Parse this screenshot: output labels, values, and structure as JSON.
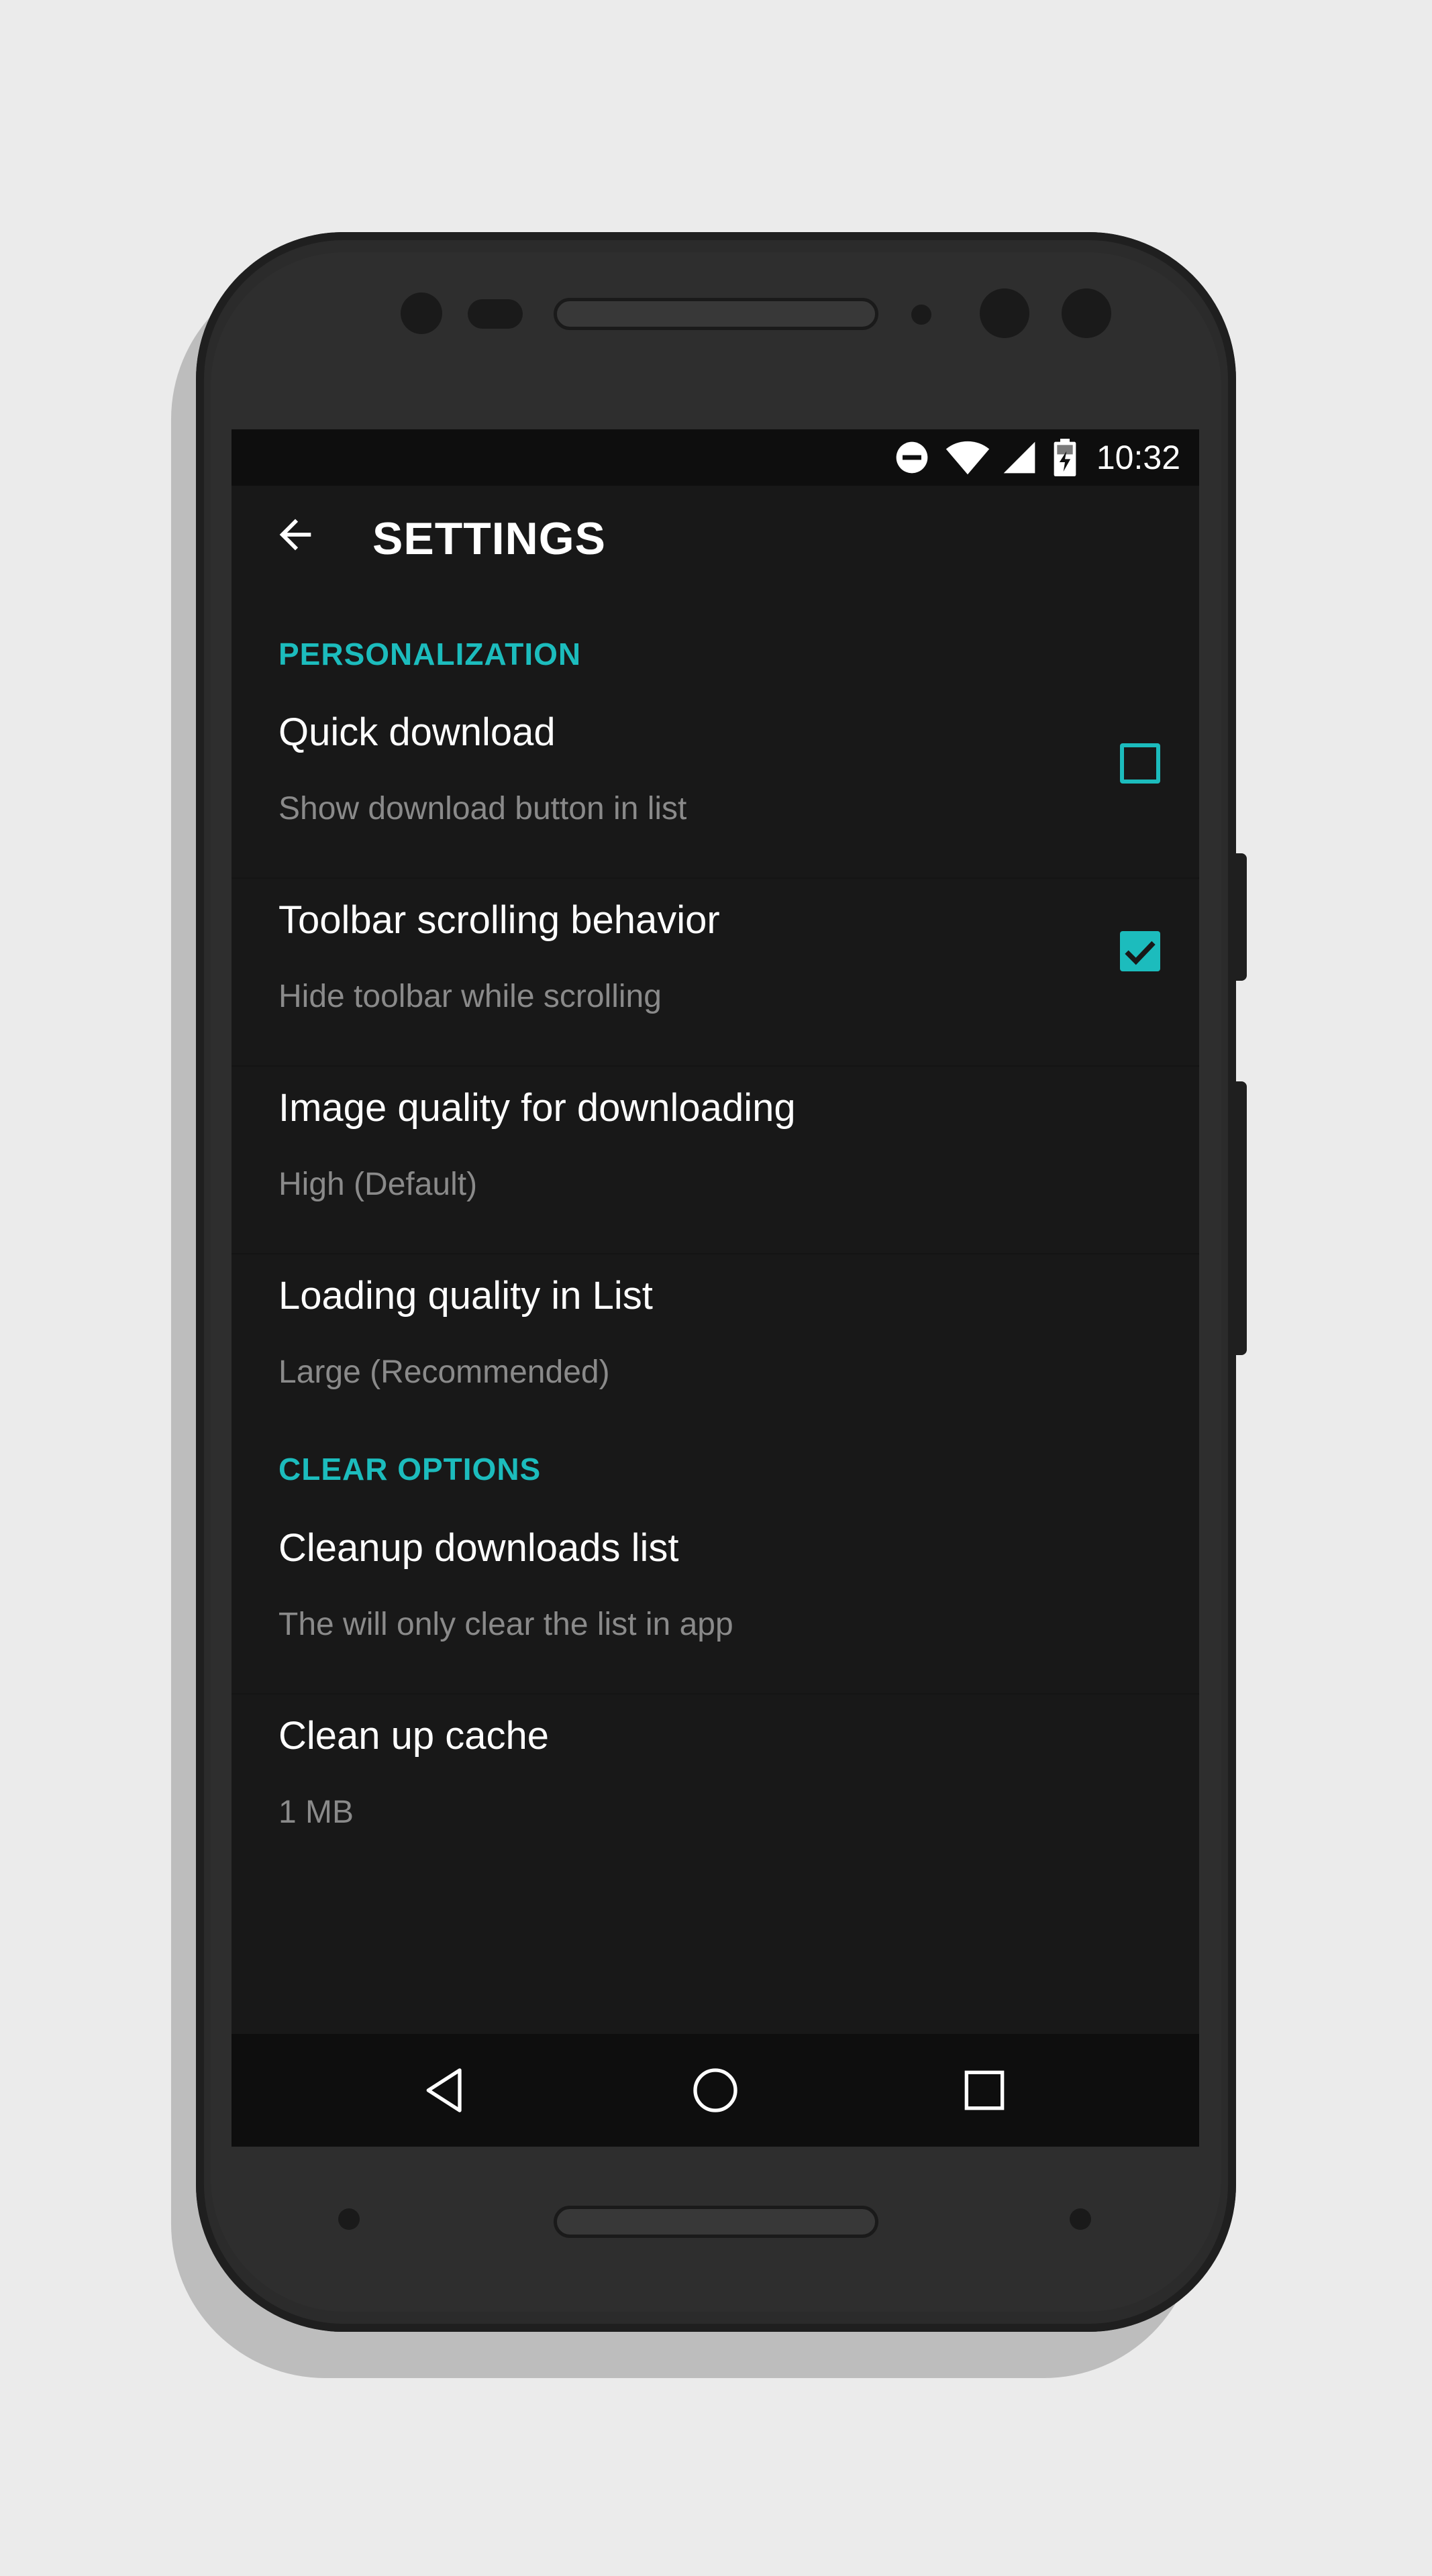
{
  "status_bar": {
    "time": "10:32",
    "icons": [
      "do-not-disturb-icon",
      "wifi-icon",
      "signal-icon",
      "battery-charging-icon"
    ]
  },
  "toolbar": {
    "title": "SETTINGS",
    "back_icon": "arrow-back-icon"
  },
  "sections": [
    {
      "header": "PERSONALIZATION",
      "items": [
        {
          "title": "Quick download",
          "summary": "Show download button in list",
          "checked": false
        },
        {
          "title": "Toolbar scrolling behavior",
          "summary": "Hide toolbar while scrolling",
          "checked": true
        },
        {
          "title": "Image quality for downloading",
          "summary": "High (Default)"
        },
        {
          "title": "Loading quality in List",
          "summary": "Large (Recommended)"
        }
      ]
    },
    {
      "header": "CLEAR OPTIONS",
      "items": [
        {
          "title": "Cleanup downloads list",
          "summary": "The will only clear the list in app"
        },
        {
          "title": "Clean up cache",
          "summary": "1 MB"
        }
      ]
    }
  ],
  "nav_bar": {
    "buttons": [
      "back-triangle-icon",
      "home-circle-icon",
      "recents-square-icon"
    ]
  },
  "colors": {
    "accent": "#1cbcbd",
    "background": "#181818",
    "page_background": "#ebebeb"
  }
}
